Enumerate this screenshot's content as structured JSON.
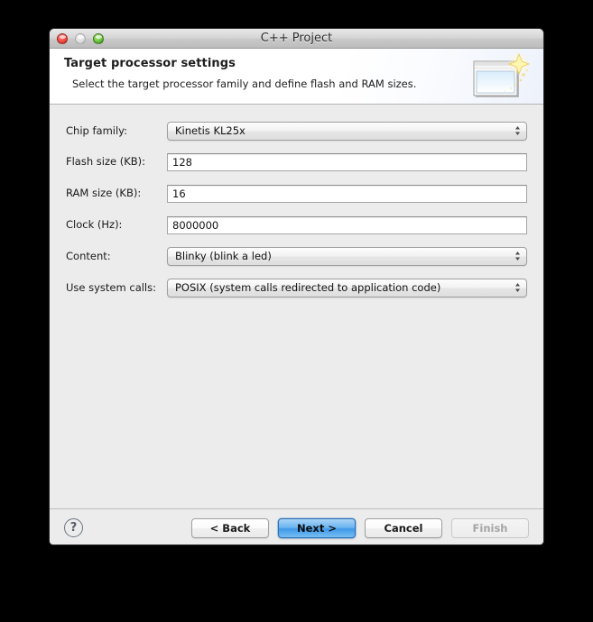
{
  "window": {
    "title": "C++ Project",
    "controls": [
      {
        "name": "close",
        "label": "Close"
      },
      {
        "name": "minimize",
        "label": "Minimize"
      },
      {
        "name": "zoom",
        "label": "Zoom"
      }
    ]
  },
  "header": {
    "title": "Target processor settings",
    "description": "Select the target processor family and define flash and RAM sizes.",
    "icon": "new-wizard-banner-icon"
  },
  "form": {
    "fields": [
      {
        "label": "Chip family:",
        "type": "popup",
        "name": "chip-family",
        "value": "Kinetis KL25x"
      },
      {
        "label": "Flash size (KB):",
        "type": "text",
        "name": "flash-size",
        "value": "128",
        "placeholder": ""
      },
      {
        "label": "RAM size (KB):",
        "type": "text",
        "name": "ram-size",
        "value": "16",
        "placeholder": ""
      },
      {
        "label": "Clock (Hz):",
        "type": "text",
        "name": "clock",
        "value": "8000000",
        "placeholder": ""
      },
      {
        "label": "Content:",
        "type": "popup",
        "name": "content",
        "value": "Blinky (blink a led)"
      },
      {
        "label": "Use system calls:",
        "type": "popup",
        "name": "use-system-calls",
        "value": "POSIX (system calls redirected to application code)"
      }
    ]
  },
  "footer": {
    "help_label": "?",
    "buttons": [
      {
        "name": "back",
        "label": "< Back",
        "state": "normal"
      },
      {
        "name": "next",
        "label": "Next >",
        "state": "default"
      },
      {
        "name": "cancel",
        "label": "Cancel",
        "state": "normal"
      },
      {
        "name": "finish",
        "label": "Finish",
        "state": "disabled"
      }
    ]
  },
  "colors": {
    "default_button": "#3f9ae9",
    "window_body": "#ececec",
    "header_background": "#ffffff",
    "desktop": "#000000"
  }
}
